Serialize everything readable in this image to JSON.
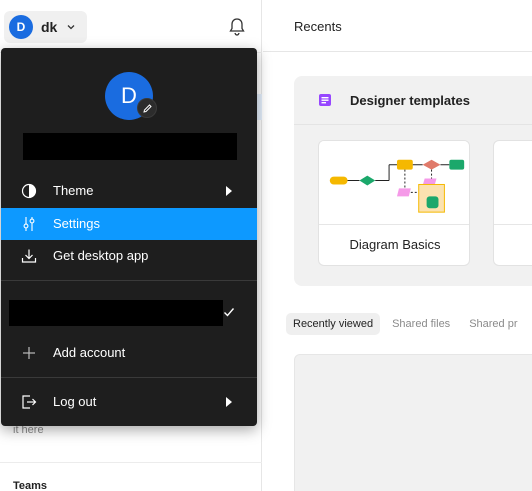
{
  "account": {
    "avatar_letter": "D",
    "name": "dk"
  },
  "sidebar": {
    "hint_text": "it here",
    "teams_label": "Teams"
  },
  "main": {
    "title": "Recents",
    "templates": {
      "title": "Designer templates",
      "cards": [
        {
          "label": "Diagram Basics"
        },
        {
          "label": ""
        }
      ]
    },
    "tabs": [
      {
        "label": "Recently viewed",
        "active": true
      },
      {
        "label": "Shared files",
        "active": false
      },
      {
        "label": "Shared pr",
        "active": false
      }
    ]
  },
  "menu": {
    "avatar_letter": "D",
    "items": [
      {
        "label": "Theme",
        "icon": "theme-icon",
        "has_submenu": true
      },
      {
        "label": "Settings",
        "icon": "settings-sliders-icon",
        "selected": true
      },
      {
        "label": "Get desktop app",
        "icon": "download-icon"
      },
      {
        "label": "Add account",
        "icon": "plus-icon"
      },
      {
        "label": "Log out",
        "icon": "logout-icon",
        "has_submenu": true
      }
    ]
  },
  "colors": {
    "accent_blue": "#0d99ff",
    "avatar_blue": "#1a6ce0",
    "menu_bg": "#1e1e1e",
    "template_purple": "#9747ff"
  }
}
